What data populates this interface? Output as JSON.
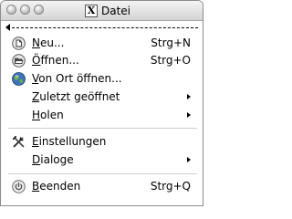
{
  "window": {
    "title": "Datei",
    "title_icon": "x11-icon",
    "title_icon_glyph": "X",
    "controls": [
      "close-button",
      "minimize-button",
      "zoom-button"
    ]
  },
  "tearoff": {
    "icon": "tearoff-arrow-icon"
  },
  "menu": {
    "items": [
      {
        "mnemonic": "N",
        "rest": "eu...",
        "accel": "Strg+N",
        "icon": "new-file-icon"
      },
      {
        "mnemonic": "Ö",
        "rest": "ffnen...",
        "accel": "Strg+O",
        "icon": "open-folder-icon"
      },
      {
        "mnemonic": "V",
        "rest": "on Ort öffnen...",
        "accel": "",
        "icon": "globe-icon"
      },
      {
        "mnemonic": "Z",
        "rest": "uletzt geöffnet",
        "submenu": true
      },
      {
        "mnemonic": "H",
        "rest": "olen",
        "submenu": true
      },
      {
        "mnemonic": "E",
        "rest": "instellungen",
        "accel": "",
        "icon": "settings-tools-icon"
      },
      {
        "mnemonic": "D",
        "rest": "ialoge",
        "submenu": true
      },
      {
        "mnemonic": "B",
        "rest": "eenden",
        "accel": "Strg+Q",
        "icon": "power-icon"
      }
    ]
  }
}
